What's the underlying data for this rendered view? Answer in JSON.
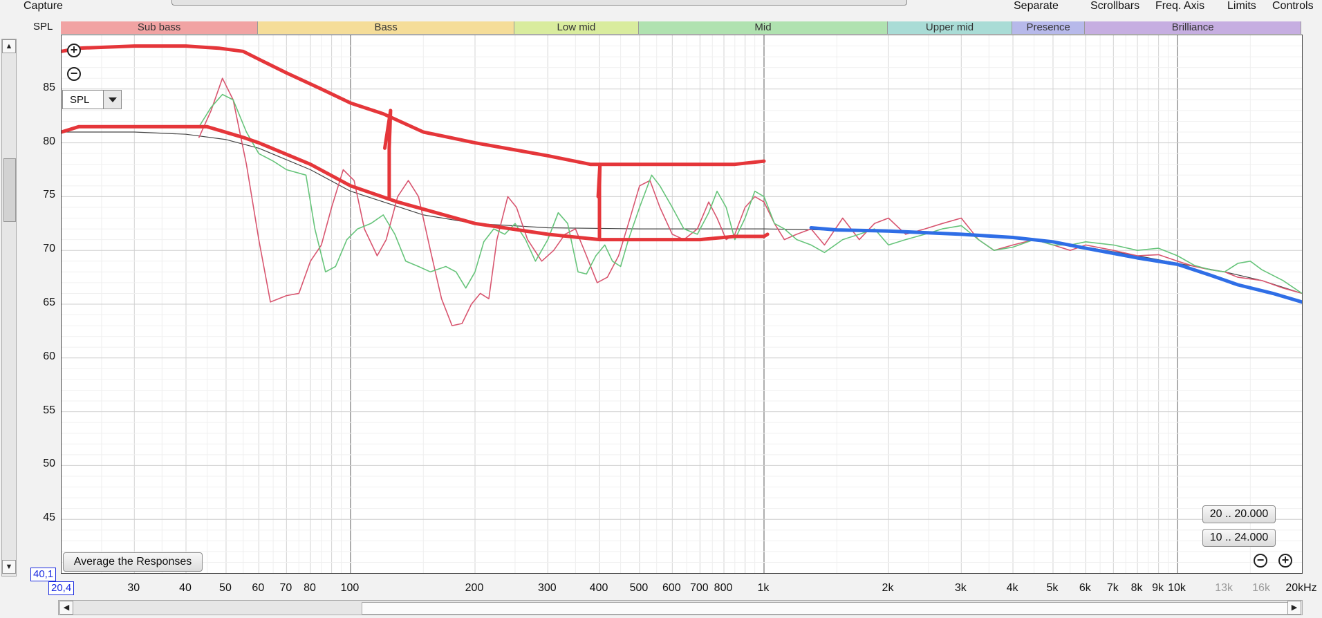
{
  "toolbar": {
    "capture_label": "Capture",
    "separate_label": "Separate",
    "scrollbars_label": "Scrollbars",
    "freq_axis_label": "Freq. Axis",
    "limits_label": "Limits",
    "controls_label": "Controls"
  },
  "axis": {
    "y_label": "SPL",
    "corner_y": "40,1",
    "corner_x": "20,4"
  },
  "controls": {
    "spl_select_value": "SPL",
    "average_button": "Average the Responses",
    "range_button_1": "20 .. 20.000",
    "range_button_2": "10 .. 24.000"
  },
  "colors": {
    "sub_bass": "#f1a3a3",
    "bass": "#f5dd99",
    "low_mid": "#d9ec9e",
    "mid": "#b0e2b0",
    "upper_mid": "#a9dcd6",
    "presence": "#b7b9ea",
    "brilliance": "#c6aee1",
    "red_trace": "#d8556f",
    "green_trace": "#66c47a",
    "target_trace": "#444444",
    "red_markup": "#e5363a",
    "blue_markup": "#2f6ee6"
  },
  "chart_data": {
    "type": "line",
    "xscale": "log",
    "xlim": [
      20,
      20000
    ],
    "ylim": [
      40,
      90
    ],
    "ylabel": "SPL",
    "yticks": [
      45,
      50,
      55,
      60,
      65,
      70,
      75,
      80,
      85
    ],
    "xticks": [
      {
        "v": 30,
        "label": "30"
      },
      {
        "v": 40,
        "label": "40"
      },
      {
        "v": 50,
        "label": "50"
      },
      {
        "v": 60,
        "label": "60"
      },
      {
        "v": 70,
        "label": "70"
      },
      {
        "v": 80,
        "label": "80"
      },
      {
        "v": 100,
        "label": "100"
      },
      {
        "v": 200,
        "label": "200"
      },
      {
        "v": 300,
        "label": "300"
      },
      {
        "v": 400,
        "label": "400"
      },
      {
        "v": 500,
        "label": "500"
      },
      {
        "v": 600,
        "label": "600"
      },
      {
        "v": 700,
        "label": "700"
      },
      {
        "v": 800,
        "label": "800"
      },
      {
        "v": 1000,
        "label": "1k"
      },
      {
        "v": 2000,
        "label": "2k"
      },
      {
        "v": 3000,
        "label": "3k"
      },
      {
        "v": 4000,
        "label": "4k"
      },
      {
        "v": 5000,
        "label": "5k"
      },
      {
        "v": 6000,
        "label": "6k"
      },
      {
        "v": 7000,
        "label": "7k"
      },
      {
        "v": 8000,
        "label": "8k"
      },
      {
        "v": 9000,
        "label": "9k"
      },
      {
        "v": 10000,
        "label": "10k"
      },
      {
        "v": 13000,
        "label": "13k",
        "dim": true
      },
      {
        "v": 16000,
        "label": "16k",
        "dim": true
      },
      {
        "v": 20000,
        "label": "20kHz"
      }
    ],
    "bands": [
      {
        "name": "Sub bass",
        "from": 20,
        "to": 60,
        "color": "#f1a3a3"
      },
      {
        "name": "Bass",
        "from": 60,
        "to": 250,
        "color": "#f5dd99"
      },
      {
        "name": "Low mid",
        "from": 250,
        "to": 500,
        "color": "#d9ec9e"
      },
      {
        "name": "Mid",
        "from": 500,
        "to": 2000,
        "color": "#b0e2b0"
      },
      {
        "name": "Upper mid",
        "from": 2000,
        "to": 4000,
        "color": "#a9dcd6"
      },
      {
        "name": "Presence",
        "from": 4000,
        "to": 6000,
        "color": "#b7b9ea"
      },
      {
        "name": "Brilliance",
        "from": 6000,
        "to": 20000,
        "color": "#c6aee1"
      }
    ],
    "series": [
      {
        "color": "#444444",
        "width": 1.2,
        "points": [
          [
            20,
            81
          ],
          [
            30,
            81
          ],
          [
            40,
            80.8
          ],
          [
            50,
            80.3
          ],
          [
            60,
            79.5
          ],
          [
            80,
            77.5
          ],
          [
            100,
            75.5
          ],
          [
            150,
            73.3
          ],
          [
            200,
            72.5
          ],
          [
            300,
            72.1
          ],
          [
            500,
            72
          ],
          [
            1000,
            72
          ],
          [
            2000,
            71.8
          ],
          [
            3000,
            71.5
          ],
          [
            4000,
            71.2
          ],
          [
            5000,
            70.8
          ],
          [
            6000,
            70.3
          ],
          [
            8000,
            69.5
          ],
          [
            10000,
            68.8
          ],
          [
            13000,
            68
          ],
          [
            16000,
            67.2
          ],
          [
            20000,
            66
          ]
        ]
      },
      {
        "color": "#d8556f",
        "width": 1.6,
        "points": [
          [
            43,
            80.5
          ],
          [
            46,
            83
          ],
          [
            49,
            86
          ],
          [
            52,
            84
          ],
          [
            56,
            78
          ],
          [
            60,
            71
          ],
          [
            64,
            65.2
          ],
          [
            70,
            65.8
          ],
          [
            75,
            66
          ],
          [
            80,
            69
          ],
          [
            85,
            70.5
          ],
          [
            90,
            74
          ],
          [
            96,
            77.5
          ],
          [
            102,
            76.5
          ],
          [
            108,
            72
          ],
          [
            116,
            69.5
          ],
          [
            122,
            71
          ],
          [
            130,
            75
          ],
          [
            138,
            76.5
          ],
          [
            146,
            75
          ],
          [
            156,
            70
          ],
          [
            166,
            65.5
          ],
          [
            176,
            63
          ],
          [
            186,
            63.2
          ],
          [
            196,
            65
          ],
          [
            206,
            66
          ],
          [
            216,
            65.5
          ],
          [
            226,
            71
          ],
          [
            240,
            75
          ],
          [
            252,
            74
          ],
          [
            268,
            71
          ],
          [
            290,
            69
          ],
          [
            310,
            70
          ],
          [
            330,
            71.5
          ],
          [
            350,
            72
          ],
          [
            372,
            69.5
          ],
          [
            395,
            67
          ],
          [
            418,
            67.5
          ],
          [
            445,
            69.5
          ],
          [
            470,
            72.5
          ],
          [
            500,
            76
          ],
          [
            530,
            76.5
          ],
          [
            560,
            74
          ],
          [
            600,
            71.5
          ],
          [
            640,
            71
          ],
          [
            690,
            72
          ],
          [
            735,
            74.5
          ],
          [
            770,
            73
          ],
          [
            810,
            71
          ],
          [
            850,
            71.5
          ],
          [
            900,
            74
          ],
          [
            950,
            75
          ],
          [
            1000,
            74.5
          ],
          [
            1060,
            72.5
          ],
          [
            1120,
            71
          ],
          [
            1200,
            71.5
          ],
          [
            1300,
            72
          ],
          [
            1400,
            70.5
          ],
          [
            1550,
            73
          ],
          [
            1700,
            71
          ],
          [
            1850,
            72.5
          ],
          [
            2000,
            73
          ],
          [
            2200,
            71.5
          ],
          [
            2450,
            72
          ],
          [
            2700,
            72.5
          ],
          [
            3000,
            73
          ],
          [
            3300,
            71
          ],
          [
            3600,
            70
          ],
          [
            4000,
            70.5
          ],
          [
            4500,
            71
          ],
          [
            5000,
            70.5
          ],
          [
            5500,
            70
          ],
          [
            6000,
            70.5
          ],
          [
            7000,
            70
          ],
          [
            8000,
            69.5
          ],
          [
            9000,
            69.6
          ],
          [
            10000,
            69
          ],
          [
            11000,
            68.5
          ],
          [
            12000,
            68.2
          ],
          [
            13000,
            68
          ],
          [
            14000,
            67.5
          ],
          [
            16000,
            67.2
          ],
          [
            18000,
            66.5
          ],
          [
            20000,
            66
          ]
        ]
      },
      {
        "color": "#66c47a",
        "width": 1.6,
        "points": [
          [
            43,
            81.5
          ],
          [
            46,
            83.3
          ],
          [
            49,
            84.5
          ],
          [
            52,
            84
          ],
          [
            56,
            81
          ],
          [
            60,
            79
          ],
          [
            65,
            78.3
          ],
          [
            70,
            77.5
          ],
          [
            78,
            77
          ],
          [
            82,
            72
          ],
          [
            87,
            68
          ],
          [
            92,
            68.5
          ],
          [
            98,
            71
          ],
          [
            104,
            72
          ],
          [
            112,
            72.5
          ],
          [
            120,
            73.3
          ],
          [
            128,
            71.5
          ],
          [
            136,
            69
          ],
          [
            146,
            68.5
          ],
          [
            156,
            68
          ],
          [
            170,
            68.5
          ],
          [
            180,
            68
          ],
          [
            190,
            66.5
          ],
          [
            200,
            68
          ],
          [
            210,
            70.8
          ],
          [
            222,
            72
          ],
          [
            236,
            71.5
          ],
          [
            250,
            72.5
          ],
          [
            265,
            71
          ],
          [
            280,
            69
          ],
          [
            300,
            71
          ],
          [
            318,
            73.5
          ],
          [
            335,
            72.5
          ],
          [
            355,
            68
          ],
          [
            372,
            67.8
          ],
          [
            392,
            69.5
          ],
          [
            412,
            70.5
          ],
          [
            430,
            69
          ],
          [
            450,
            68.5
          ],
          [
            470,
            71
          ],
          [
            500,
            74
          ],
          [
            535,
            77
          ],
          [
            560,
            76
          ],
          [
            600,
            74
          ],
          [
            640,
            72
          ],
          [
            690,
            71.5
          ],
          [
            735,
            73.5
          ],
          [
            770,
            75.5
          ],
          [
            810,
            74
          ],
          [
            850,
            71
          ],
          [
            900,
            73
          ],
          [
            950,
            75.5
          ],
          [
            1000,
            75
          ],
          [
            1060,
            72.5
          ],
          [
            1120,
            72
          ],
          [
            1200,
            71
          ],
          [
            1300,
            70.5
          ],
          [
            1400,
            69.8
          ],
          [
            1550,
            71
          ],
          [
            1700,
            71.5
          ],
          [
            1850,
            72
          ],
          [
            2000,
            70.5
          ],
          [
            2200,
            71
          ],
          [
            2450,
            71.5
          ],
          [
            2700,
            72
          ],
          [
            3000,
            72.3
          ],
          [
            3300,
            71
          ],
          [
            3600,
            70
          ],
          [
            4000,
            70.3
          ],
          [
            4500,
            71
          ],
          [
            5000,
            70.5
          ],
          [
            5500,
            70.5
          ],
          [
            6000,
            70.8
          ],
          [
            7000,
            70.5
          ],
          [
            8000,
            70
          ],
          [
            9000,
            70.2
          ],
          [
            10000,
            69.5
          ],
          [
            11000,
            68.6
          ],
          [
            12000,
            68.2
          ],
          [
            13000,
            68
          ],
          [
            14000,
            68.8
          ],
          [
            15000,
            69
          ],
          [
            16000,
            68.2
          ],
          [
            18000,
            67.2
          ],
          [
            20000,
            66
          ]
        ]
      },
      {
        "color": "#e5363a",
        "width": 5,
        "points": [
          [
            20,
            88.5
          ],
          [
            22,
            88.8
          ],
          [
            30,
            89
          ],
          [
            40,
            89
          ],
          [
            48,
            88.8
          ],
          [
            55,
            88.5
          ],
          [
            62,
            87.5
          ],
          [
            70,
            86.5
          ],
          [
            85,
            85
          ],
          [
            100,
            83.7
          ],
          [
            120,
            82.7
          ],
          [
            150,
            81
          ],
          [
            200,
            80
          ],
          [
            300,
            78.8
          ],
          [
            380,
            78
          ],
          [
            500,
            78
          ],
          [
            700,
            78
          ],
          [
            850,
            78
          ],
          [
            1000,
            78.3
          ]
        ]
      },
      {
        "color": "#e5363a",
        "width": 5,
        "points": [
          [
            20,
            81
          ],
          [
            22,
            81.5
          ],
          [
            30,
            81.5
          ],
          [
            45,
            81.5
          ],
          [
            55,
            80.5
          ],
          [
            60,
            80
          ],
          [
            80,
            78
          ],
          [
            100,
            76
          ],
          [
            130,
            74.5
          ],
          [
            200,
            72.5
          ],
          [
            300,
            71.5
          ],
          [
            400,
            71
          ],
          [
            500,
            71
          ],
          [
            700,
            71
          ],
          [
            850,
            71.3
          ],
          [
            1000,
            71.3
          ],
          [
            1020,
            71.5
          ]
        ]
      },
      {
        "color": "#2f6ee6",
        "width": 5,
        "points": [
          [
            1300,
            72.1
          ],
          [
            1500,
            71.9
          ],
          [
            2000,
            71.8
          ],
          [
            3000,
            71.5
          ],
          [
            4000,
            71.2
          ],
          [
            5000,
            70.8
          ],
          [
            6000,
            70.2
          ],
          [
            8000,
            69.3
          ],
          [
            10000,
            68.7
          ],
          [
            12000,
            67.7
          ],
          [
            14000,
            66.8
          ],
          [
            17000,
            66
          ],
          [
            20000,
            65.2
          ]
        ]
      },
      {
        "color": "#e5363a",
        "width": 5,
        "points": [
          [
            124,
            74.8
          ],
          [
            124,
            79.5
          ],
          [
            125,
            83
          ],
          [
            121,
            79.5
          ]
        ]
      },
      {
        "color": "#e5363a",
        "width": 5,
        "points": [
          [
            400,
            71.2
          ],
          [
            400,
            76
          ],
          [
            401,
            78
          ],
          [
            397,
            75
          ]
        ]
      }
    ]
  }
}
